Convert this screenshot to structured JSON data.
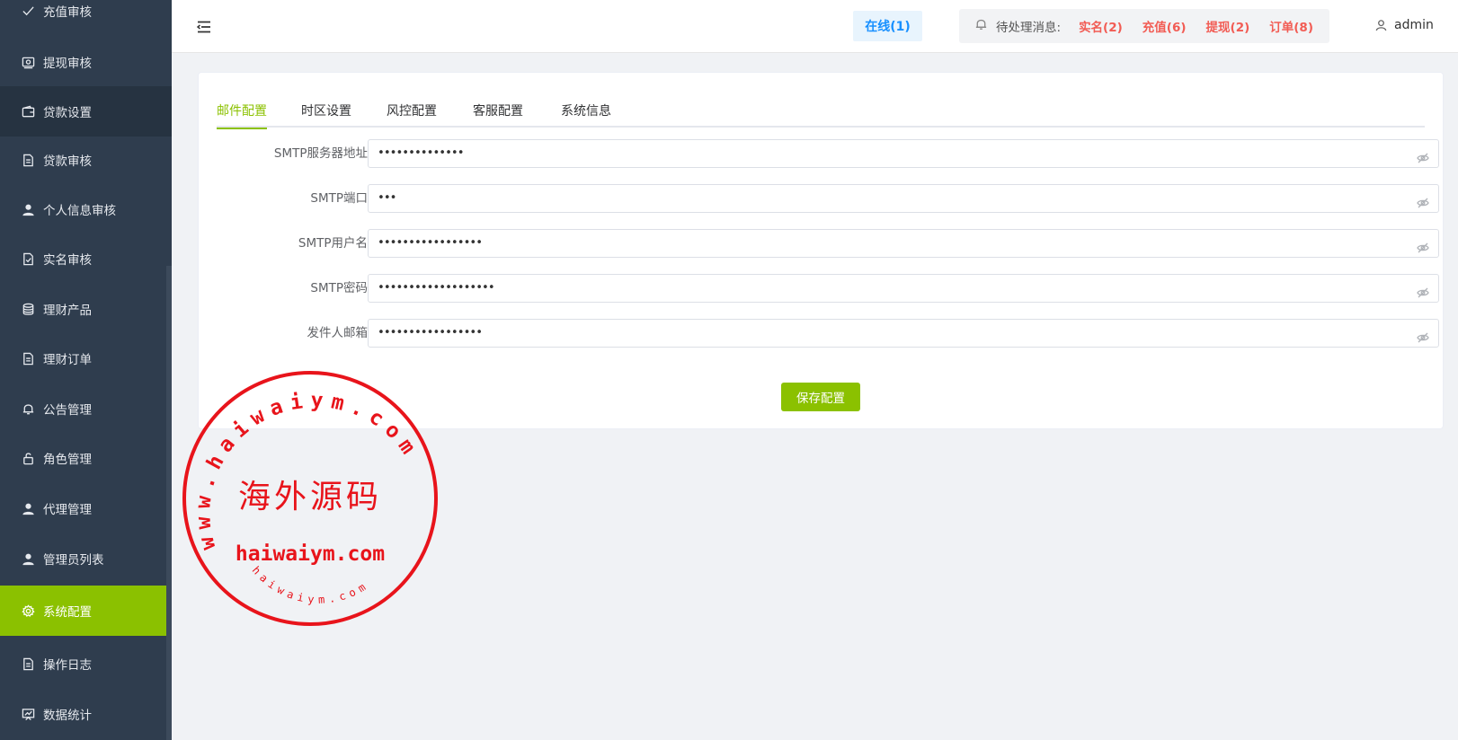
{
  "sidebar": {
    "items": [
      {
        "label": "充值审核",
        "icon": "check-icon"
      },
      {
        "label": "提现审核",
        "icon": "money-icon"
      },
      {
        "label": "贷款设置",
        "icon": "wallet-icon"
      },
      {
        "label": "贷款审核",
        "icon": "document-icon"
      },
      {
        "label": "个人信息审核",
        "icon": "user-icon"
      },
      {
        "label": "实名审核",
        "icon": "document-check-icon"
      },
      {
        "label": "理财产品",
        "icon": "coins-icon"
      },
      {
        "label": "理财订单",
        "icon": "document-icon"
      },
      {
        "label": "公告管理",
        "icon": "bell-icon"
      },
      {
        "label": "角色管理",
        "icon": "lock-icon"
      },
      {
        "label": "代理管理",
        "icon": "user-icon"
      },
      {
        "label": "管理员列表",
        "icon": "user-icon"
      },
      {
        "label": "系统配置",
        "icon": "gear-icon",
        "active": true
      },
      {
        "label": "操作日志",
        "icon": "document-icon"
      },
      {
        "label": "数据统计",
        "icon": "chart-board-icon"
      }
    ]
  },
  "header": {
    "online": "在线(1)",
    "notify_label": "待处理消息:",
    "notify_links": [
      "实名(2)",
      "充值(6)",
      "提现(2)",
      "订单(8)"
    ],
    "user": "admin"
  },
  "tabs": [
    "邮件配置",
    "时区设置",
    "风控配置",
    "客服配置",
    "系统信息"
  ],
  "active_tab": "邮件配置",
  "form": {
    "fields": [
      {
        "label": "SMTP服务器地址",
        "value": "••••••••••••••"
      },
      {
        "label": "SMTP端口",
        "value": "•••"
      },
      {
        "label": "SMTP用户名",
        "value": "•••••••••••••••••"
      },
      {
        "label": "SMTP密码",
        "value": "•••••••••••••••••••"
      },
      {
        "label": "发件人邮箱",
        "value": "•••••••••••••••••"
      }
    ],
    "save_label": "保存配置"
  },
  "watermark": {
    "ring_text": "www.haiwaiym.com",
    "center_text": "海外源码",
    "domain_text": "haiwaiym.com",
    "small_ring_text": "haiwaiym.com"
  },
  "colors": {
    "sidebar_bg": "#2f3d4e",
    "accent": "#8bc100",
    "notify_red": "#f25c54",
    "online_blue": "#1890ff",
    "stamp_red": "#e8141b"
  }
}
